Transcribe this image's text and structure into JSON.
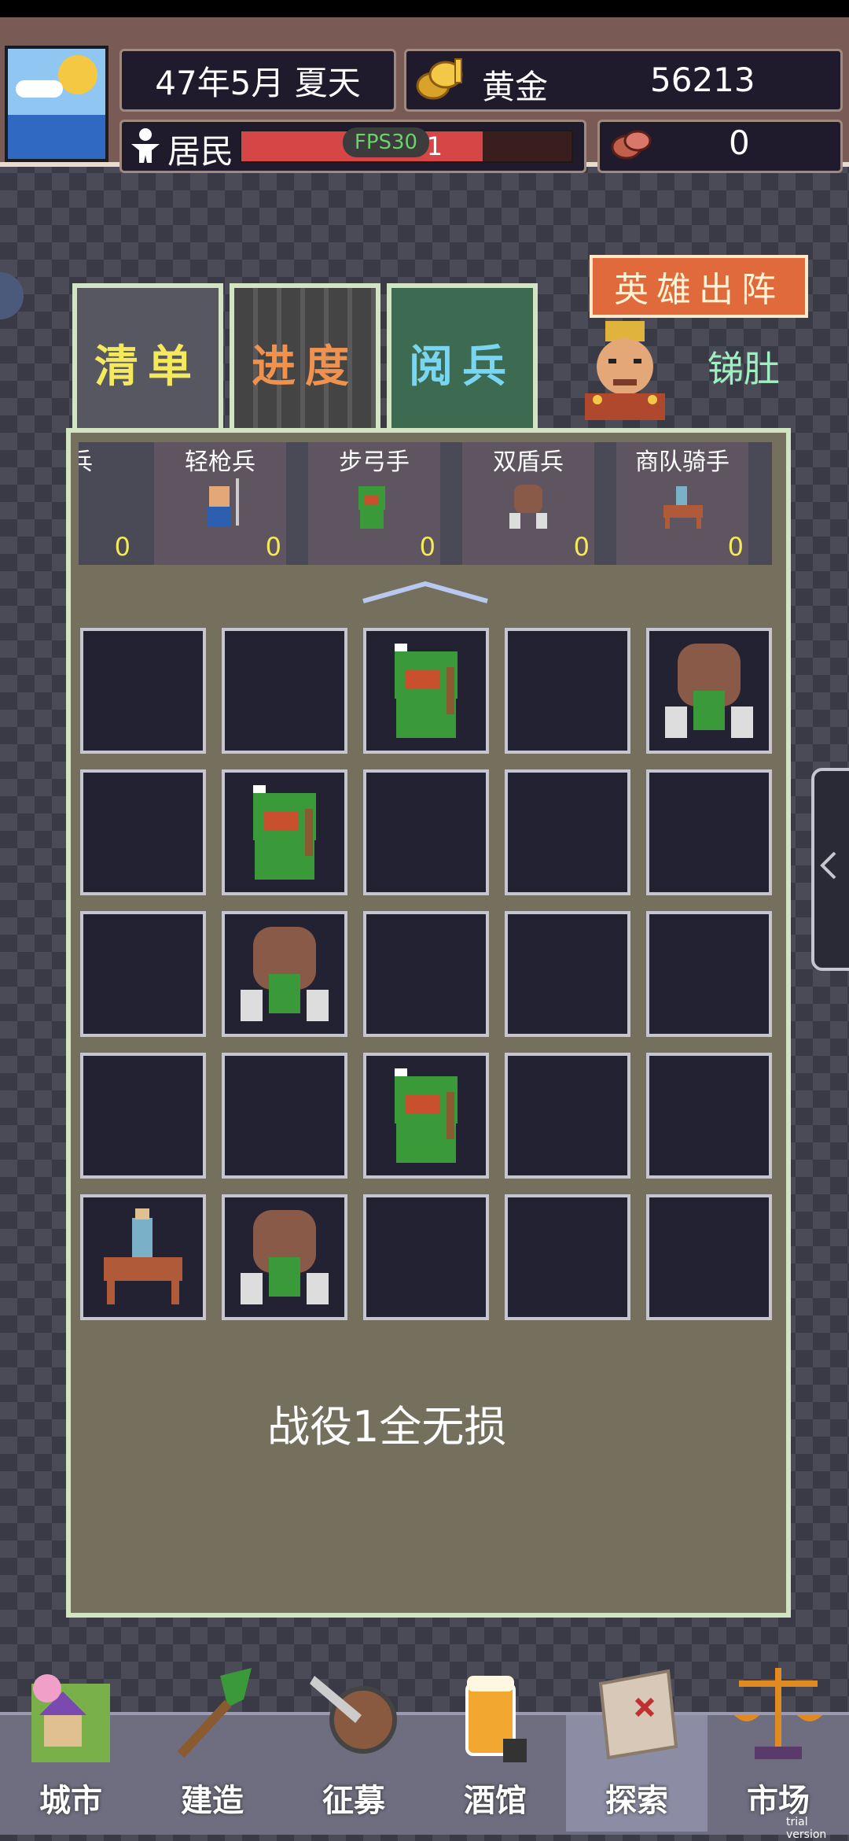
{
  "topbar": {
    "date": "47年5月 夏天",
    "gold_label": "黄金",
    "gold_value": "56213",
    "residents_label": "居民",
    "residents_value": "52/71",
    "residents_fraction": 0.732,
    "meat_value": "0",
    "fps": "FPS30"
  },
  "tabs": [
    {
      "label": "清单"
    },
    {
      "label": "进度"
    },
    {
      "label": "阅兵"
    }
  ],
  "hero": {
    "button_label": "英雄出阵",
    "name": "锑肚"
  },
  "units": [
    {
      "name": "步兵",
      "count": "0"
    },
    {
      "name": "轻枪兵",
      "count": "0"
    },
    {
      "name": "步弓手",
      "count": "0"
    },
    {
      "name": "双盾兵",
      "count": "0"
    },
    {
      "name": "商队骑手",
      "count": "0"
    }
  ],
  "grid": [
    [
      "empty",
      "empty",
      "archer",
      "empty",
      "shield"
    ],
    [
      "empty",
      "archer",
      "empty",
      "empty",
      "empty"
    ],
    [
      "empty",
      "shield",
      "empty",
      "empty",
      "empty"
    ],
    [
      "empty",
      "empty",
      "archer",
      "empty",
      "empty"
    ],
    [
      "rider",
      "shield",
      "empty",
      "empty",
      "empty"
    ]
  ],
  "battle_text": "战役1全无损",
  "nav": [
    {
      "label": "城市",
      "icon": "city-icon"
    },
    {
      "label": "建造",
      "icon": "shovel-icon"
    },
    {
      "label": "征募",
      "icon": "sword-shield-icon"
    },
    {
      "label": "酒馆",
      "icon": "beer-icon"
    },
    {
      "label": "探索",
      "icon": "map-icon"
    },
    {
      "label": "市场",
      "icon": "scale-icon"
    }
  ],
  "trial_text": "trial version",
  "colors": {
    "accent_red": "#d74646",
    "tab_active": "#3c6b52",
    "hero_button": "#e06a3c"
  }
}
